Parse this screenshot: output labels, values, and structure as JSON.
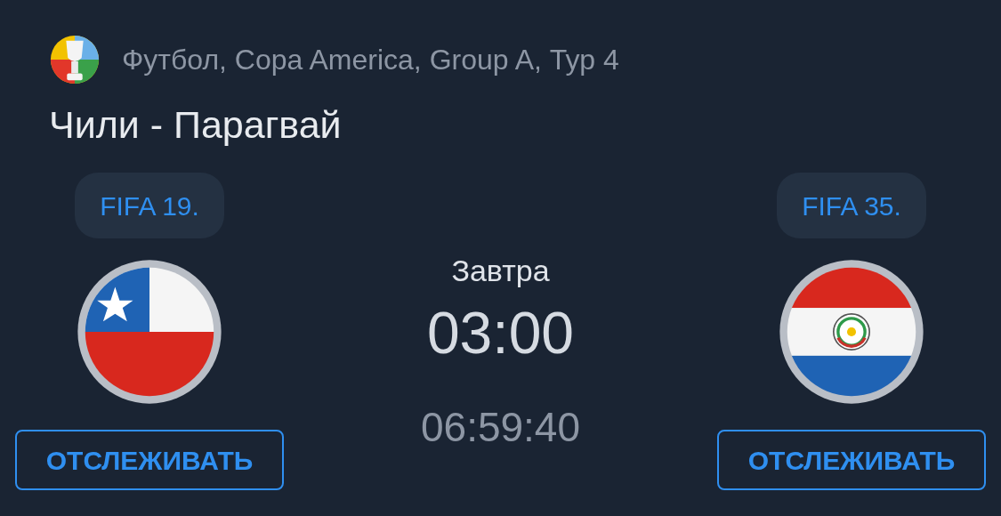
{
  "header": {
    "competition": "Футбол, Copa America, Group A, Тур 4"
  },
  "match": {
    "title": "Чили - Парагвай",
    "day": "Завтра",
    "time": "03:00",
    "countdown": "06:59:40"
  },
  "teams": [
    {
      "rank": "FIFA 19.",
      "kind": "chile",
      "button": "ОТСЛЕЖИВАТЬ"
    },
    {
      "rank": "FIFA 35.",
      "kind": "paraguay",
      "button": "ОТСЛЕЖИВАТЬ"
    }
  ]
}
